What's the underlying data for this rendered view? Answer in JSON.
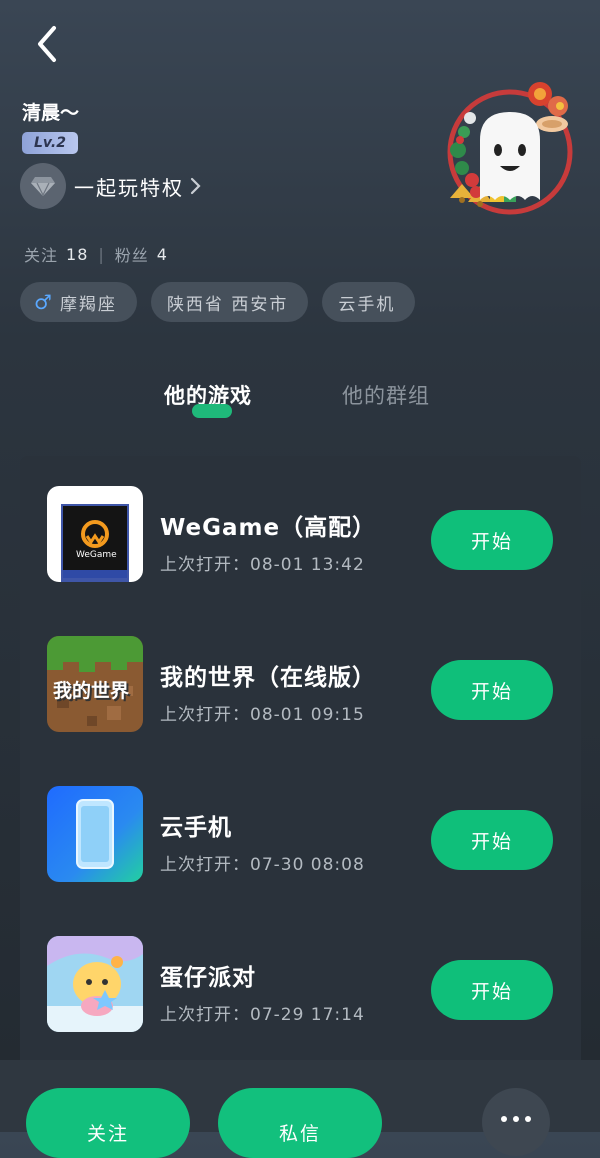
{
  "profile": {
    "nickname": "清晨～",
    "level": "Lv.2",
    "privilege_label": "一起玩特权",
    "follow_label": "关注",
    "follow_count": "18",
    "fans_label": "粉丝",
    "fans_count": "4",
    "tags": {
      "zodiac": "摩羯座",
      "location": "陕西省 西安市",
      "device": "云手机"
    }
  },
  "tabs": {
    "my_games": "他的游戏",
    "my_groups": "他的群组",
    "active": "my_games"
  },
  "games": [
    {
      "name": "WeGame（高配）",
      "last_open": "上次打开：08-01 13:42",
      "button": "开始",
      "icon": "wegame-icon"
    },
    {
      "name": "我的世界（在线版）",
      "last_open": "上次打开：08-01 09:15",
      "button": "开始",
      "icon": "minecraft-icon"
    },
    {
      "name": "云手机",
      "last_open": "上次打开：07-30 08:08",
      "button": "开始",
      "icon": "cloud-phone-icon"
    },
    {
      "name": "蛋仔派对",
      "last_open": "上次打开：07-29 17:14",
      "button": "开始",
      "icon": "eggy-party-icon"
    }
  ],
  "bottom": {
    "follow": "关注",
    "message": "私信"
  },
  "icon_labels": {
    "wegame_brand": "WeGame",
    "minecraft_logo": "我的世界"
  },
  "colors": {
    "accent": "#12c07d",
    "panel": "#2a323b",
    "background": "#232a31"
  }
}
